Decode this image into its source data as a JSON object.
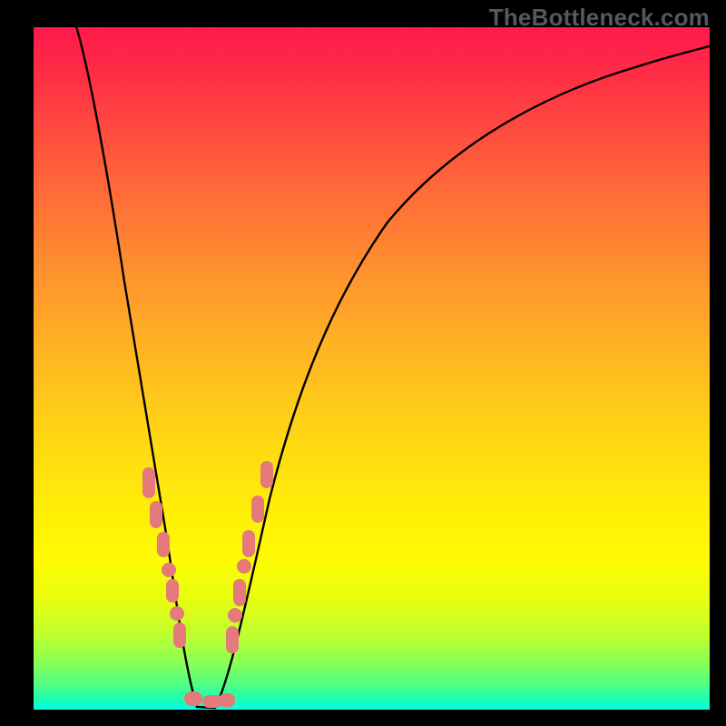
{
  "watermark": "TheBottleneck.com",
  "chart_data": {
    "type": "line",
    "title": "",
    "xlabel": "",
    "ylabel": "",
    "xlim": [
      0,
      100
    ],
    "ylim": [
      0,
      100
    ],
    "grid": false,
    "legend": false,
    "description": "Bottleneck curve over red-to-green vertical gradient, minimum near x≈24",
    "series": [
      {
        "name": "bottleneck-curve",
        "color": "#000000",
        "x": [
          6,
          8,
          10,
          12,
          14,
          16,
          18,
          20,
          22,
          24,
          26,
          28,
          30,
          34,
          38,
          44,
          52,
          60,
          70,
          82,
          94,
          100
        ],
        "values": [
          100,
          88,
          76,
          64,
          52,
          40,
          30,
          18,
          8,
          0,
          0,
          6,
          14,
          28,
          40,
          52,
          63,
          72,
          80,
          86,
          91,
          93
        ]
      }
    ],
    "markers": [
      {
        "name": "left-cluster",
        "color": "#e47a7a",
        "x": [
          16.5,
          17.2,
          18.0,
          19.0,
          19.8,
          20.6,
          21.2
        ],
        "y": [
          35,
          32,
          28,
          21,
          17,
          12,
          9
        ]
      },
      {
        "name": "valley-cluster",
        "color": "#e47a7a",
        "x": [
          22.4,
          23.2,
          24.0,
          24.8,
          25.6,
          26.4
        ],
        "y": [
          1.5,
          0.8,
          0.5,
          0.5,
          0.8,
          1.2
        ]
      },
      {
        "name": "right-cluster",
        "color": "#e47a7a",
        "x": [
          28.0,
          28.8,
          29.6,
          30.4,
          31.4,
          32.4,
          33.4
        ],
        "y": [
          9,
          12,
          16,
          20,
          25,
          30,
          35
        ]
      }
    ],
    "gradient_stops": [
      {
        "pos": 0.0,
        "color": "#ff1a4b"
      },
      {
        "pos": 0.35,
        "color": "#ff8f2f"
      },
      {
        "pos": 0.7,
        "color": "#ffed08"
      },
      {
        "pos": 0.93,
        "color": "#8bff55"
      },
      {
        "pos": 1.0,
        "color": "#00ffe8"
      }
    ]
  }
}
